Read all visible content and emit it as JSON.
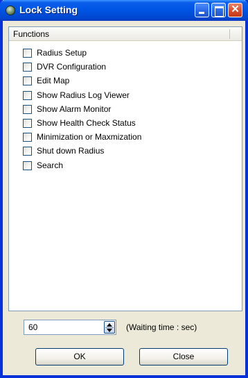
{
  "window": {
    "title": "Lock Setting"
  },
  "list": {
    "header": "Functions",
    "items": [
      {
        "label": "Radius Setup",
        "checked": false
      },
      {
        "label": "DVR Configuration",
        "checked": false
      },
      {
        "label": "Edit Map",
        "checked": false
      },
      {
        "label": "Show Radius Log Viewer",
        "checked": false
      },
      {
        "label": "Show Alarm Monitor",
        "checked": false
      },
      {
        "label": "Show Health Check Status",
        "checked": false
      },
      {
        "label": "Minimization or Maxmization",
        "checked": false
      },
      {
        "label": "Shut down Radius",
        "checked": false
      },
      {
        "label": "Search",
        "checked": false
      }
    ]
  },
  "waiting": {
    "value": "60",
    "label": "(Waiting time : sec)"
  },
  "buttons": {
    "ok": "OK",
    "close": "Close"
  },
  "colors": {
    "titlebar": "#0055e5",
    "frame": "#0831d9",
    "face": "#ece9d8",
    "close_button": "#d94d2a"
  }
}
